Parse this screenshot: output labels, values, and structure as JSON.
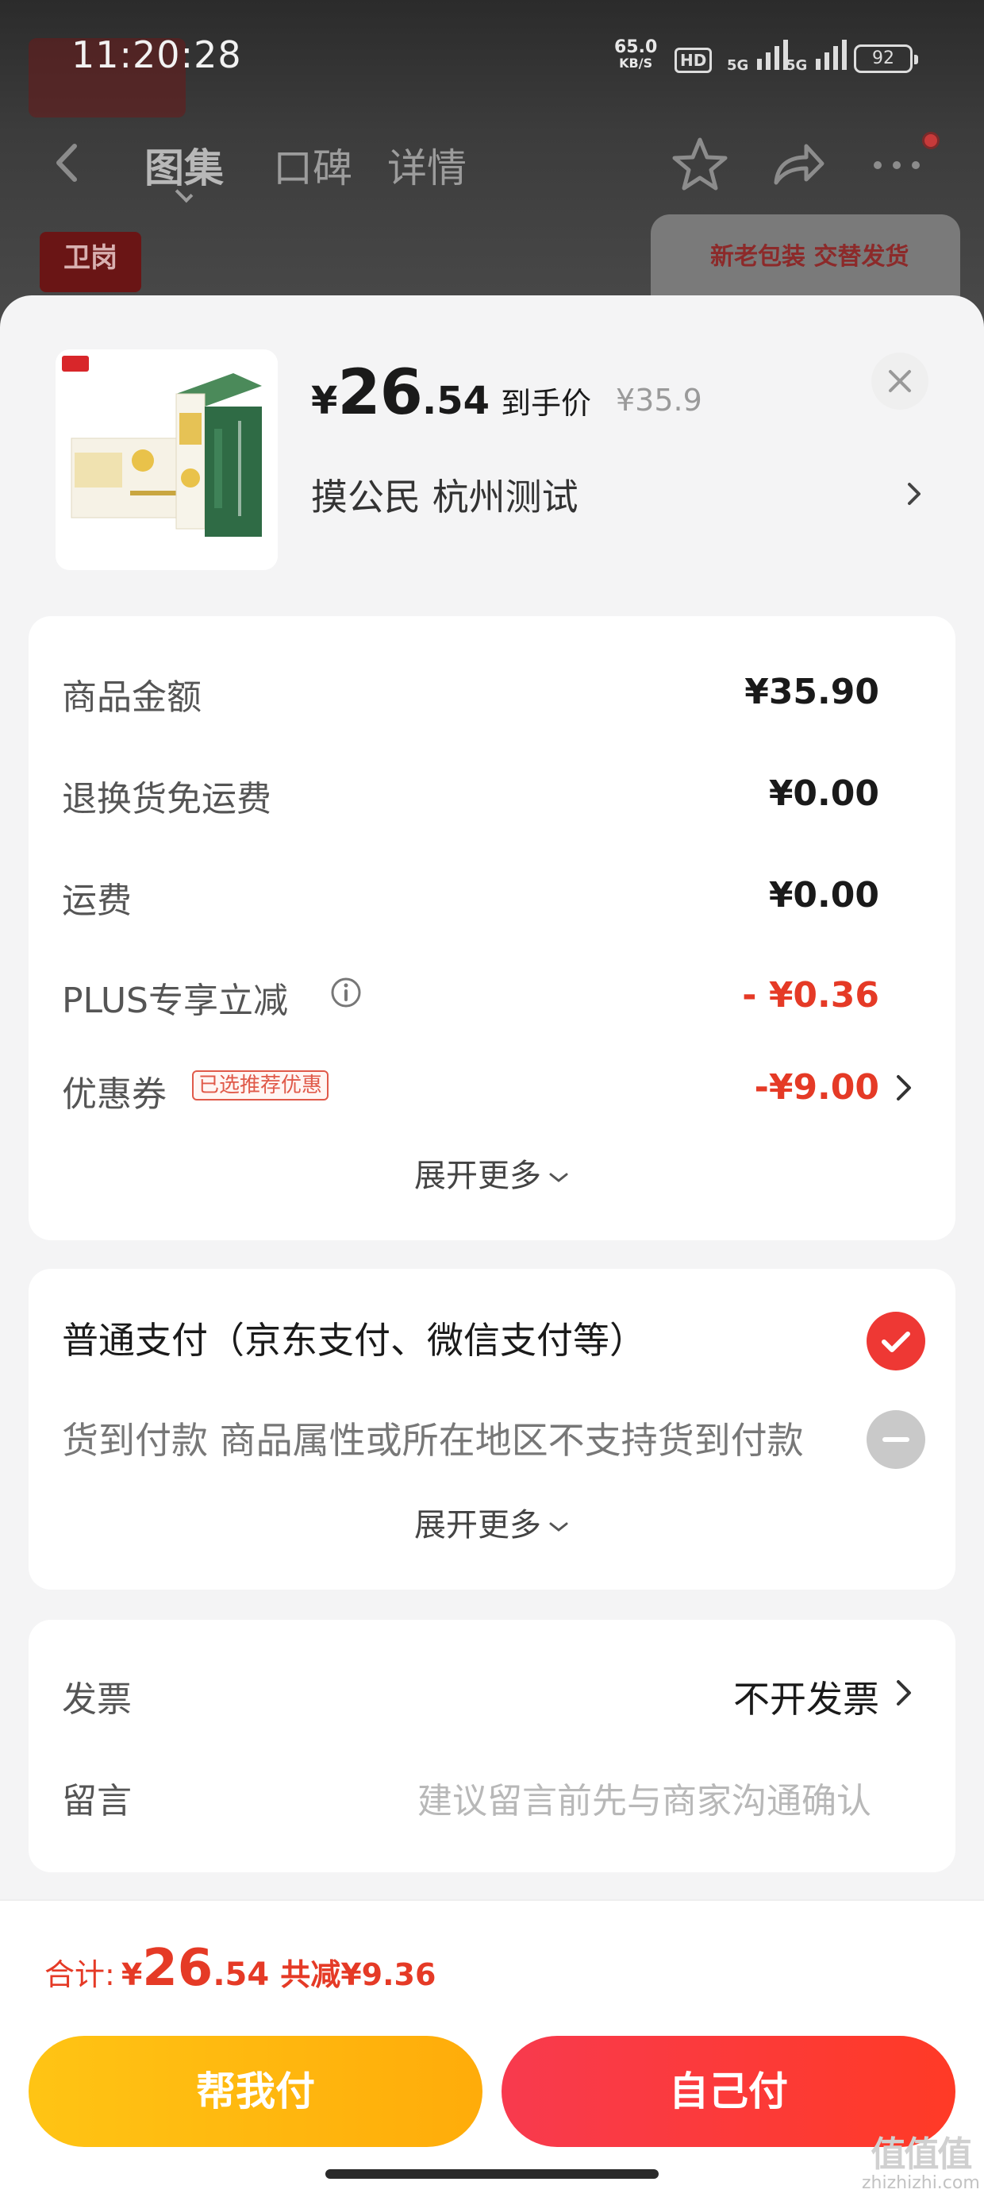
{
  "status_bar": {
    "time": "11:20:28",
    "net_speed_value": "65.0",
    "net_speed_unit": "KB/S",
    "hd_label": "HD",
    "signal_1": "5G",
    "signal_2": "5G",
    "battery": "92"
  },
  "background": {
    "tabs": [
      "图集",
      "口碑",
      "详情"
    ],
    "banner_text": "新老包装 交替发货",
    "brand_logo": "卫岗"
  },
  "product": {
    "price_yen": "¥",
    "price_int": "26",
    "price_dec": ".54",
    "price_label": "到手价",
    "original_price": "¥35.9",
    "address": "摸公民  杭州测试"
  },
  "fees": {
    "rows": [
      {
        "label": "商品金额",
        "value": "¥35.90"
      },
      {
        "label": "退换货免运费",
        "value": "¥0.00"
      },
      {
        "label": "运费",
        "value": "¥0.00"
      },
      {
        "label": "PLUS专享立减",
        "value": "- ¥0.36"
      },
      {
        "label": "优惠券",
        "value": "-¥9.00",
        "tag": "已选推荐优惠"
      }
    ],
    "more": "展开更多"
  },
  "payment": {
    "option_1": "普通支付（京东支付、微信支付等）",
    "option_2": "货到付款 商品属性或所在地区不支持货到付款",
    "more": "展开更多"
  },
  "extras": {
    "invoice_label": "发票",
    "invoice_value": "不开发票",
    "note_label": "留言",
    "note_placeholder": "建议留言前先与商家沟通确认"
  },
  "summary": {
    "label": "合计:",
    "yen": "¥",
    "int": "26",
    "dec": ".54",
    "saved": "共减¥9.36"
  },
  "buttons": {
    "help_pay": "帮我付",
    "self_pay": "自己付"
  },
  "watermark": {
    "logo": "值值值",
    "site": "zhizhizhi.com"
  },
  "colors": {
    "accent_red": "#e53a26",
    "help_pay_yellow": "#ffb80f",
    "self_pay_red": "#f83a3a"
  }
}
